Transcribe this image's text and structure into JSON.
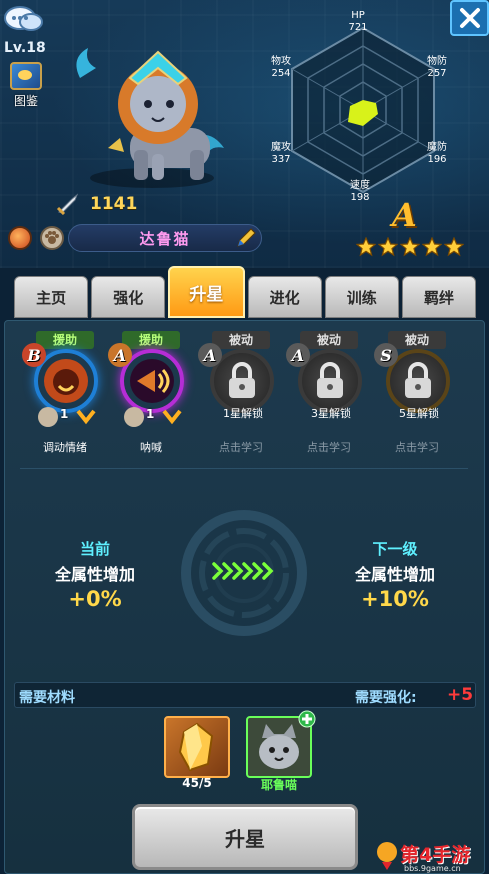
{
  "header": {
    "level": "Lv.18",
    "codex_label": "图鉴"
  },
  "hero": {
    "power": "1141",
    "name": "达鲁猫",
    "grade": "A",
    "stars": 5
  },
  "stats": {
    "hp": {
      "label": "HP",
      "value": "721"
    },
    "phys_atk": {
      "label": "物攻",
      "value": "254"
    },
    "phys_def": {
      "label": "物防",
      "value": "257"
    },
    "mag_atk": {
      "label": "魔攻",
      "value": "337"
    },
    "mag_def": {
      "label": "魔防",
      "value": "196"
    },
    "speed": {
      "label": "速度",
      "value": "198"
    }
  },
  "tabs": [
    "主页",
    "强化",
    "升星",
    "进化",
    "训练",
    "羁绊"
  ],
  "active_tab": "升星",
  "skills": [
    {
      "tag": "援助",
      "grade": "B",
      "level": "1",
      "sub": "调动情绪",
      "locked": false
    },
    {
      "tag": "援助",
      "grade": "A",
      "level": "1",
      "sub": "呐喊",
      "locked": false
    },
    {
      "tag": "被动",
      "grade": "A",
      "lock_text": "1星解锁",
      "sub": "点击学习",
      "locked": true
    },
    {
      "tag": "被动",
      "grade": "A",
      "lock_text": "3星解锁",
      "sub": "点击学习",
      "locked": true
    },
    {
      "tag": "被动",
      "grade": "S",
      "lock_text": "5星解锁",
      "sub": "点击学习",
      "locked": true
    }
  ],
  "upgrade": {
    "current_label": "当前",
    "current_desc": "全属性增加",
    "current_value": "+0%",
    "next_label": "下一级",
    "next_desc": "全属性增加",
    "next_value": "+10%"
  },
  "materials": {
    "title": "需要材料",
    "required_label": "需要强化:",
    "required_value": "+5",
    "items": [
      {
        "count": "45/5"
      },
      {
        "name": "耶鲁喵"
      }
    ]
  },
  "button": {
    "label": "升星"
  },
  "watermark": {
    "text": "第4手游",
    "url": "bbs.9game.cn"
  },
  "colors": {
    "accent_gold": "#ffd84a",
    "tab_active": "#ffa51f",
    "cyan_label": "#5ff0ff",
    "warn_red": "#ff3b3b",
    "name_pink": "#ff9bf0"
  }
}
